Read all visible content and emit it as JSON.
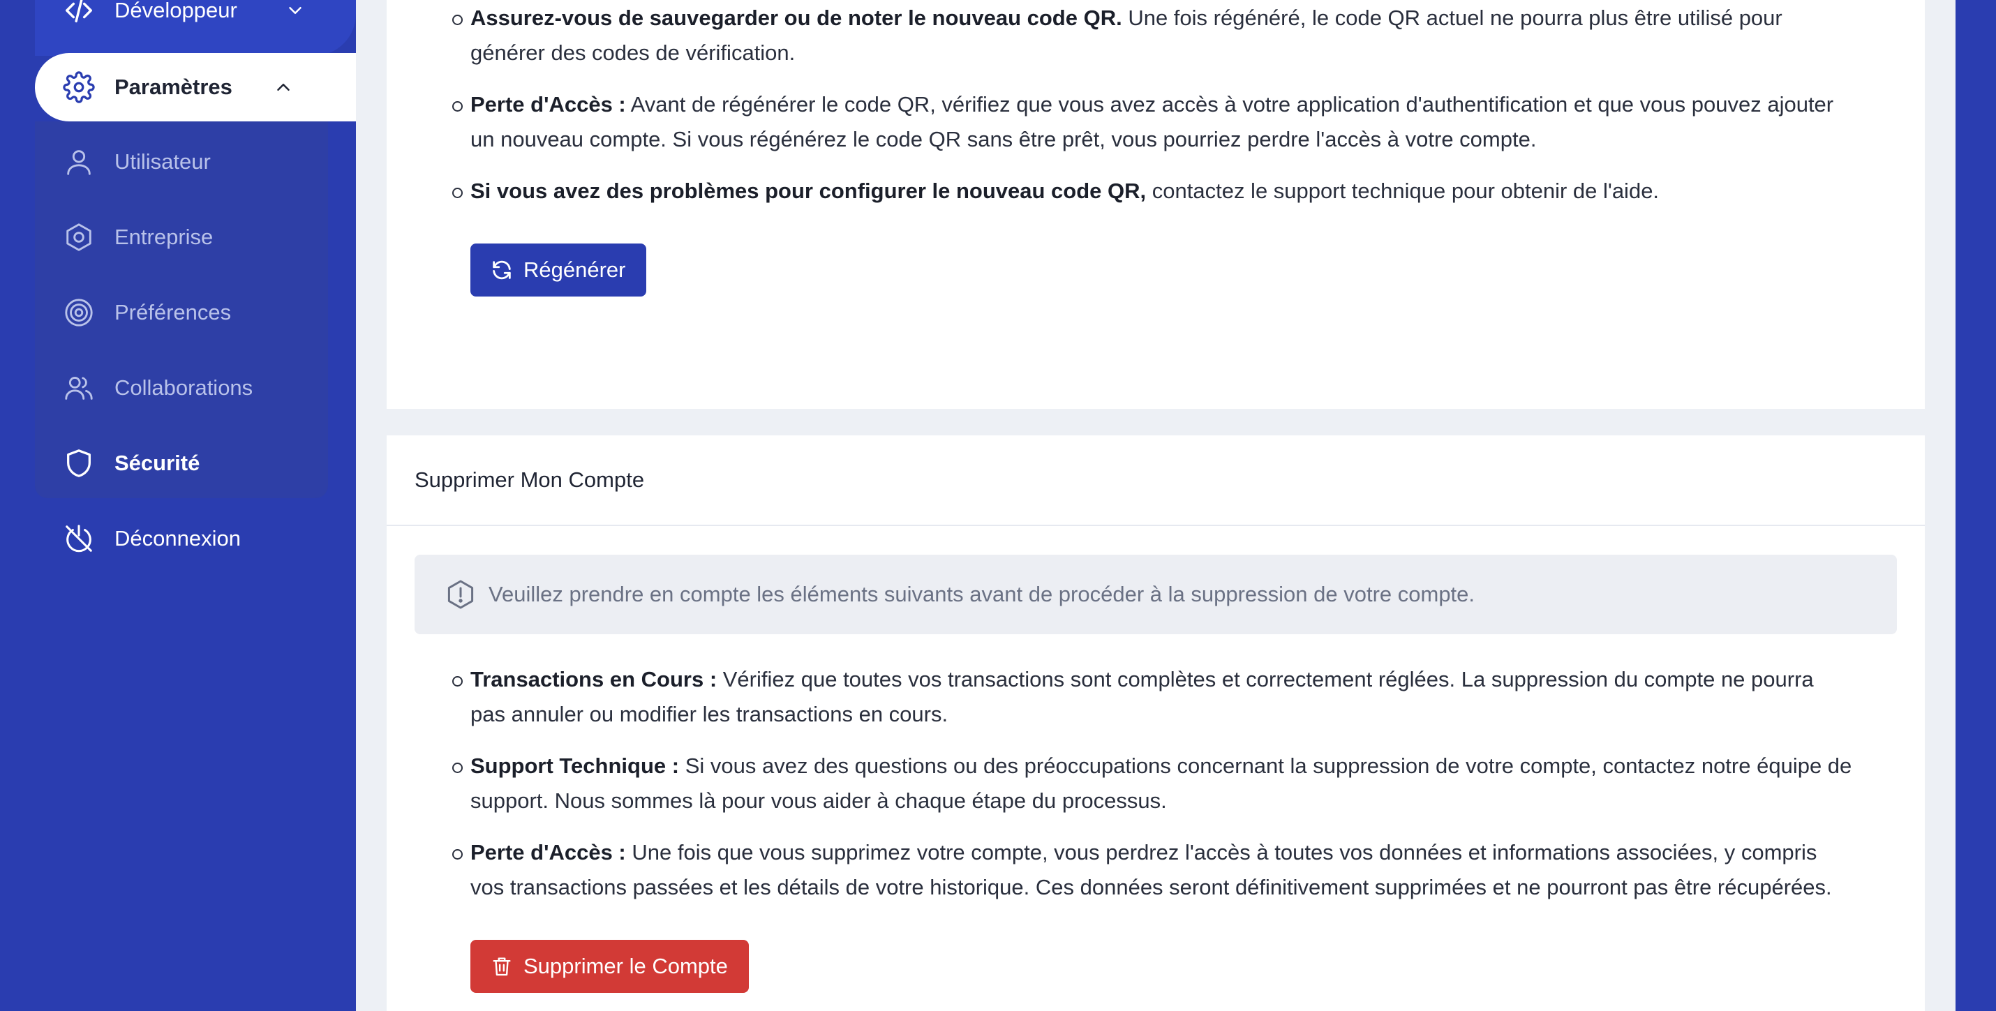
{
  "sidebar": {
    "developer_label": "Développeur",
    "settings_label": "Paramètres",
    "submenu": [
      {
        "label": "Utilisateur",
        "icon": "user-icon"
      },
      {
        "label": "Entreprise",
        "icon": "hexagon-icon"
      },
      {
        "label": "Préférences",
        "icon": "target-icon"
      },
      {
        "label": "Collaborations",
        "icon": "users-icon"
      },
      {
        "label": "Sécurité",
        "icon": "shield-icon"
      }
    ],
    "logout_label": "Déconnexion"
  },
  "qr_card": {
    "points": [
      {
        "bold": "Assurez-vous de sauvegarder ou de noter le nouveau code QR.",
        "text": " Une fois régénéré, le code QR actuel ne pourra plus être utilisé pour générer des codes de vérification."
      },
      {
        "bold": "Perte d'Accès :",
        "text": " Avant de régénérer le code QR, vérifiez que vous avez accès à votre application d'authentification et que vous pouvez ajouter un nouveau compte. Si vous régénérez le code QR sans être prêt, vous pourriez perdre l'accès à votre compte."
      },
      {
        "bold": "Si vous avez des problèmes pour configurer le nouveau code QR,",
        "text": " contactez le support technique pour obtenir de l'aide."
      }
    ],
    "regen_label": "Régénérer"
  },
  "delete_card": {
    "title": "Supprimer Mon Compte",
    "alert": "Veuillez prendre en compte les éléments suivants avant de procéder à la suppression de votre compte.",
    "points": [
      {
        "bold": "Transactions en Cours :",
        "text": " Vérifiez que toutes vos transactions sont complètes et correctement réglées. La suppression du compte ne pourra pas annuler ou modifier les transactions en cours."
      },
      {
        "bold": "Support Technique :",
        "text": " Si vous avez des questions ou des préoccupations concernant la suppression de votre compte, contactez notre équipe de support. Nous sommes là pour vous aider à chaque étape du processus."
      },
      {
        "bold": "Perte d'Accès :",
        "text": " Une fois que vous supprimez votre compte, vous perdrez l'accès à toutes vos données et informations associées, y compris vos transactions passées et les détails de votre historique. Ces données seront définitivement supprimées et ne pourront pas être récupérées."
      }
    ],
    "delete_label": "Supprimer le Compte"
  },
  "colors": {
    "sidebar": "#2a3db0",
    "primary_button": "#2a3db0",
    "danger_button": "#d23a36"
  }
}
